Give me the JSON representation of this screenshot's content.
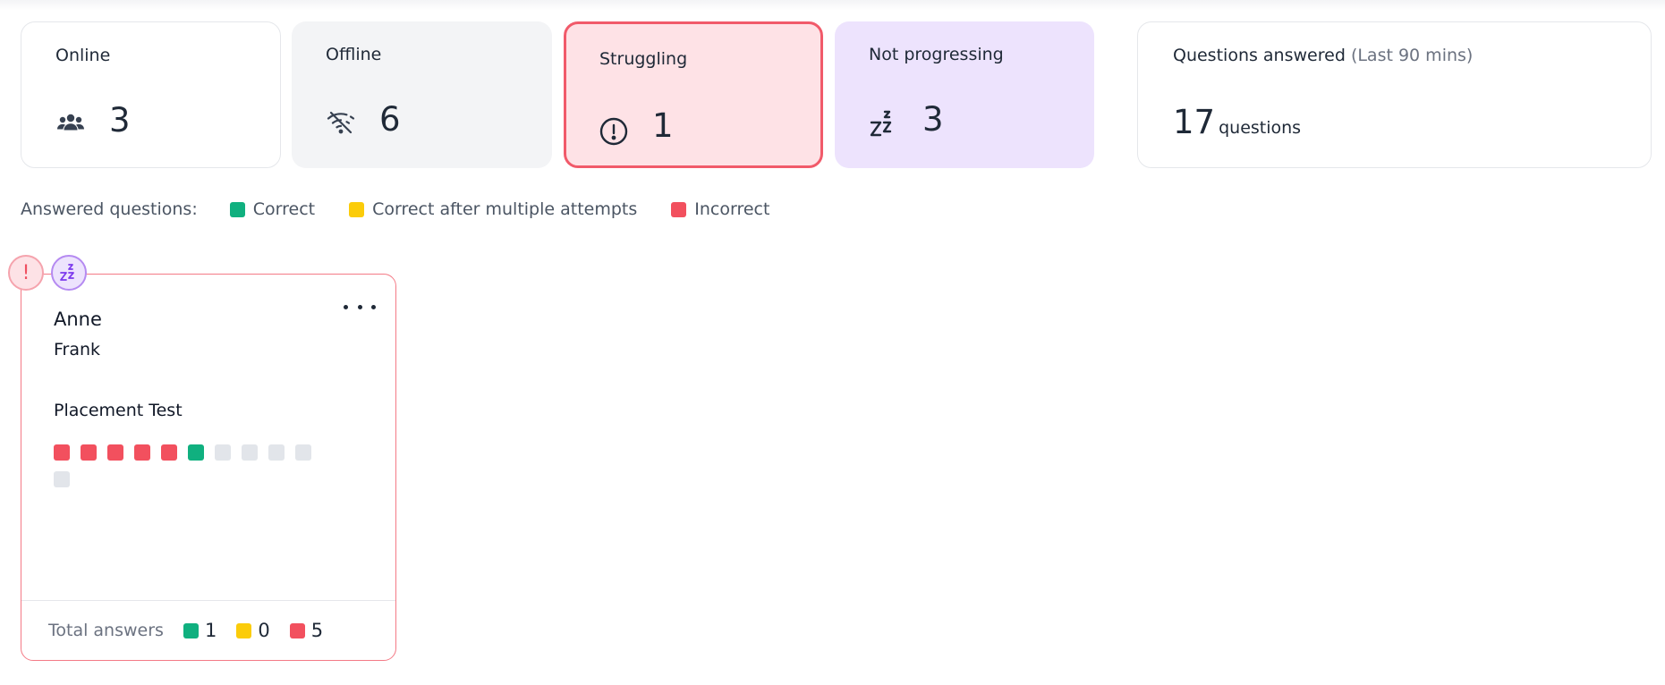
{
  "stats": {
    "online": {
      "label": "Online",
      "value": "3",
      "icon": "users-icon"
    },
    "offline": {
      "label": "Offline",
      "value": "6",
      "icon": "wifi-off-icon"
    },
    "struggling": {
      "label": "Struggling",
      "value": "1",
      "icon": "alert-circle-icon"
    },
    "not_progressing": {
      "label": "Not progressing",
      "value": "3",
      "icon": "sleep-icon"
    },
    "questions": {
      "label": "Questions answered",
      "sublabel": "(Last 90 mins)",
      "value": "17",
      "unit": "questions"
    }
  },
  "legend": {
    "title": "Answered questions:",
    "items": [
      {
        "label": "Correct",
        "color": "#10b07f"
      },
      {
        "label": "Correct after multiple attempts",
        "color": "#fbcc0a"
      },
      {
        "label": "Incorrect",
        "color": "#f2505e"
      }
    ]
  },
  "colors": {
    "correct": "#10b07f",
    "partial": "#fbcc0a",
    "incorrect": "#f2505e",
    "unanswered": "#e2e5ea"
  },
  "student": {
    "first_name": "Anne",
    "last_name": "Frank",
    "assignment": "Placement Test",
    "badges": [
      "struggling",
      "not-progressing"
    ],
    "answers": [
      "incorrect",
      "incorrect",
      "incorrect",
      "incorrect",
      "incorrect",
      "correct",
      "unanswered",
      "unanswered",
      "unanswered",
      "unanswered",
      "unanswered"
    ],
    "footer": {
      "label": "Total answers",
      "correct": "1",
      "partial": "0",
      "incorrect": "5"
    }
  }
}
